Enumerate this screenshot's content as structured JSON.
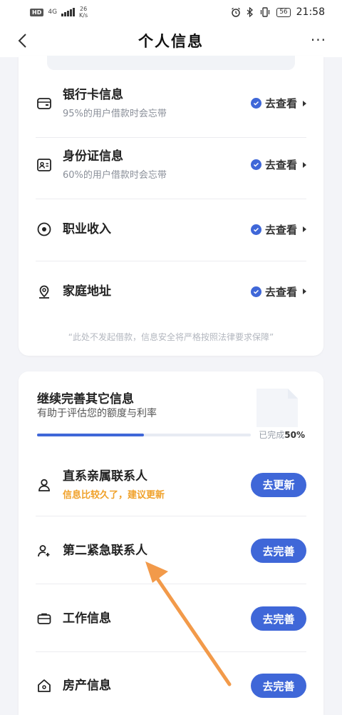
{
  "status_bar": {
    "hd": "HD",
    "network": "4G",
    "speed_value": "26",
    "speed_unit": "K/s",
    "battery": "56",
    "time": "21:58"
  },
  "nav": {
    "title": "个人信息",
    "more": "···"
  },
  "verified_section": {
    "items": [
      {
        "icon": "bank-card-icon",
        "label": "银行卡信息",
        "sub": "95%的用户借款时会忘带",
        "action": "去查看"
      },
      {
        "icon": "id-card-icon",
        "label": "身份证信息",
        "sub": "60%的用户借款时会忘带",
        "action": "去查看"
      },
      {
        "icon": "target-icon",
        "label": "职业收入",
        "action": "去查看"
      },
      {
        "icon": "location-pin-icon",
        "label": "家庭地址",
        "action": "去查看"
      }
    ],
    "footer": "“此处不发起借款，信息安全将严格按照法律要求保障”"
  },
  "complete_section": {
    "title": "继续完善其它信息",
    "subtitle": "有助于评估您的额度与利率",
    "progress_label": "已完成",
    "progress_value": "50%",
    "progress_fraction": 0.5,
    "items": [
      {
        "icon": "person-icon",
        "label": "直系亲属联系人",
        "sub": "信息比较久了，建议更新",
        "button": "去更新"
      },
      {
        "icon": "person-add-icon",
        "label": "第二紧急联系人",
        "button": "去完善"
      },
      {
        "icon": "briefcase-icon",
        "label": "工作信息",
        "button": "去完善"
      },
      {
        "icon": "house-icon",
        "label": "房产信息",
        "button": "去完善"
      }
    ]
  },
  "colors": {
    "accent": "#3f67d8",
    "warning": "#f0a12a",
    "annotation_arrow": "#f29a4a"
  }
}
